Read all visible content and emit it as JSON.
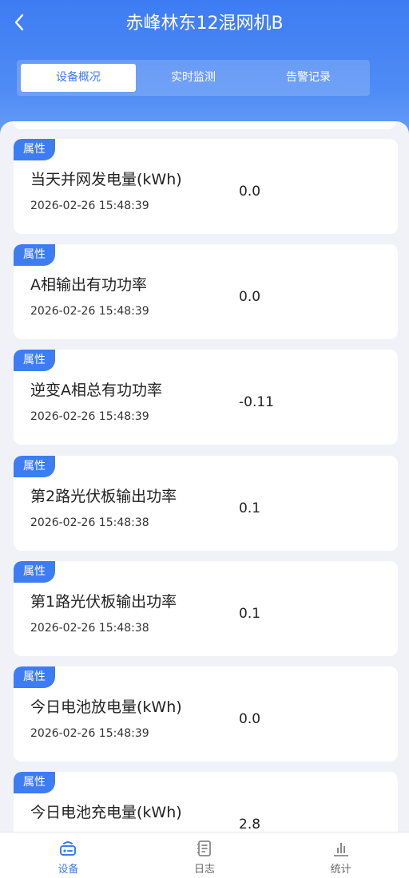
{
  "header": {
    "title": "赤峰林东12混网机B",
    "tabs": [
      {
        "label": "设备概况",
        "active": true
      },
      {
        "label": "实时监测",
        "active": false
      },
      {
        "label": "告警记录",
        "active": false
      }
    ]
  },
  "items": [
    {
      "badge": "属性",
      "name": "当天并网发电量(kWh)",
      "time": "2026-02-26 15:48:39",
      "value": "0.0"
    },
    {
      "badge": "属性",
      "name": "A相输出有功功率",
      "time": "2026-02-26 15:48:39",
      "value": "0.0"
    },
    {
      "badge": "属性",
      "name": "逆变A相总有功功率",
      "time": "2026-02-26 15:48:39",
      "value": "-0.11"
    },
    {
      "badge": "属性",
      "name": "第2路光伏板输出功率",
      "time": "2026-02-26 15:48:38",
      "value": "0.1"
    },
    {
      "badge": "属性",
      "name": "第1路光伏板输出功率",
      "time": "2026-02-26 15:48:38",
      "value": "0.1"
    },
    {
      "badge": "属性",
      "name": "今日电池放电量(kWh)",
      "time": "2026-02-26 15:48:39",
      "value": "0.0"
    },
    {
      "badge": "属性",
      "name": "今日电池充电量(kWh)",
      "time": "",
      "value": "2.8"
    }
  ],
  "bottom_nav": [
    {
      "label": "设备",
      "icon": "device-icon",
      "active": true
    },
    {
      "label": "日志",
      "icon": "log-icon",
      "active": false
    },
    {
      "label": "统计",
      "icon": "stats-icon",
      "active": false
    }
  ],
  "colors": {
    "accent": "#3d7cf3",
    "background": "#f0f2f7"
  }
}
